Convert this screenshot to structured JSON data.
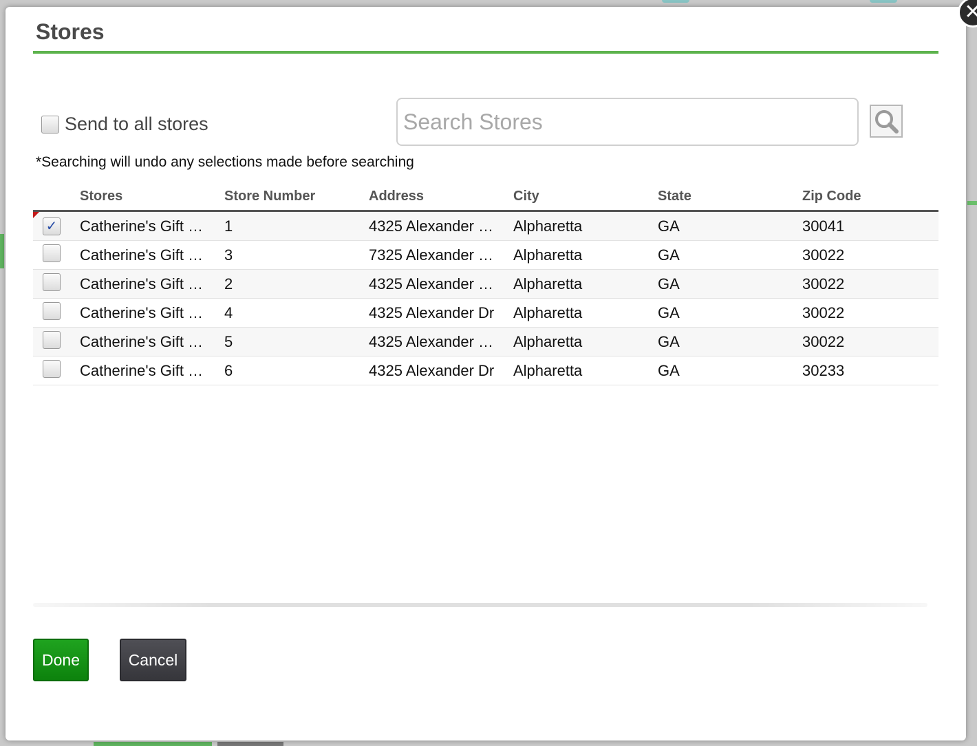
{
  "modal": {
    "title": "Stores",
    "close_label": "✕"
  },
  "send_all": {
    "label": "Send to all stores",
    "checked": false
  },
  "search": {
    "placeholder": "Search Stores",
    "value": "",
    "button_icon": "search-icon"
  },
  "note": "*Searching will undo any selections made before searching",
  "table": {
    "columns": [
      "Stores",
      "Store Number",
      "Address",
      "City",
      "State",
      "Zip Code"
    ],
    "rows": [
      {
        "checked": true,
        "checkmark": "✓",
        "store": "Catherine's Gift …",
        "number": "1",
        "address": "4325 Alexander …",
        "city": "Alpharetta",
        "state": "GA",
        "zip": "30041"
      },
      {
        "checked": false,
        "checkmark": "",
        "store": "Catherine's Gift …",
        "number": "3",
        "address": "7325 Alexander …",
        "city": "Alpharetta",
        "state": "GA",
        "zip": "30022"
      },
      {
        "checked": false,
        "checkmark": "",
        "store": "Catherine's Gift …",
        "number": "2",
        "address": "4325 Alexander …",
        "city": "Alpharetta",
        "state": "GA",
        "zip": "30022"
      },
      {
        "checked": false,
        "checkmark": "",
        "store": "Catherine's Gift …",
        "number": "4",
        "address": "4325 Alexander Dr",
        "city": "Alpharetta",
        "state": "GA",
        "zip": "30022"
      },
      {
        "checked": false,
        "checkmark": "",
        "store": "Catherine's Gift …",
        "number": "5",
        "address": "4325 Alexander …",
        "city": "Alpharetta",
        "state": "GA",
        "zip": "30022"
      },
      {
        "checked": false,
        "checkmark": "",
        "store": "Catherine's Gift …",
        "number": "6",
        "address": "4325 Alexander Dr",
        "city": "Alpharetta",
        "state": "GA",
        "zip": "30233"
      }
    ]
  },
  "footer": {
    "done_label": "Done",
    "cancel_label": "Cancel"
  },
  "colors": {
    "accent_green": "#5db34d",
    "done_green": "#1a961a",
    "cancel_gray": "#444449"
  }
}
